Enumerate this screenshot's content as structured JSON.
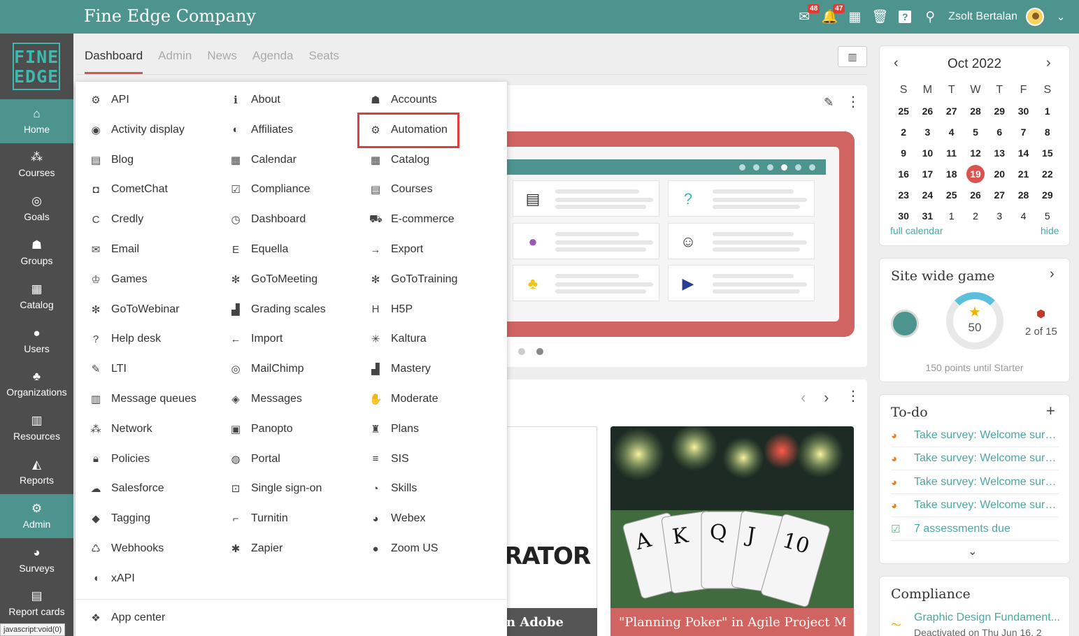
{
  "header": {
    "company": "Fine Edge Company",
    "mail_count": "48",
    "notif_count": "47",
    "user_name": "Zsolt Bertalan"
  },
  "logo": {
    "line1": "FINE",
    "line2": "EDGE"
  },
  "sidebar": {
    "items": [
      {
        "label": "Home",
        "icon": "home-icon"
      },
      {
        "label": "Courses",
        "icon": "courses-icon"
      },
      {
        "label": "Goals",
        "icon": "goals-icon"
      },
      {
        "label": "Groups",
        "icon": "groups-icon"
      },
      {
        "label": "Catalog",
        "icon": "catalog-icon"
      },
      {
        "label": "Users",
        "icon": "users-icon"
      },
      {
        "label": "Organizations",
        "icon": "organizations-icon"
      },
      {
        "label": "Resources",
        "icon": "resources-icon"
      },
      {
        "label": "Reports",
        "icon": "reports-icon"
      },
      {
        "label": "Admin",
        "icon": "admin-icon"
      },
      {
        "label": "Surveys",
        "icon": "surveys-icon"
      },
      {
        "label": "Report cards",
        "icon": "report-cards-icon"
      }
    ]
  },
  "status_bar": "javascript:void(0)",
  "tabs": [
    "Dashboard",
    "Admin",
    "News",
    "Agenda",
    "Seats"
  ],
  "admin_menu": {
    "col1": [
      "API",
      "Activity display",
      "Blog",
      "CometChat",
      "Credly",
      "Email",
      "Games",
      "GoToWebinar",
      "Help desk",
      "LTI",
      "Message queues",
      "Network",
      "Policies",
      "Salesforce",
      "Tagging",
      "Webhooks",
      "xAPI"
    ],
    "col2": [
      "About",
      "Affiliates",
      "Calendar",
      "Compliance",
      "Dashboard",
      "Equella",
      "GoToMeeting",
      "Grading scales",
      "Import",
      "MailChimp",
      "Messages",
      "Panopto",
      "Portal",
      "Single sign-on",
      "Turnitin",
      "Zapier"
    ],
    "col3": [
      "Accounts",
      "Automation",
      "Catalog",
      "Courses",
      "E-commerce",
      "Export",
      "GoToTraining",
      "H5P",
      "Kaltura",
      "Mastery",
      "Moderate",
      "Plans",
      "SIS",
      "Skills",
      "Webex",
      "Zoom US"
    ],
    "highlighted": "Automation",
    "app_center": "App center"
  },
  "featured": {
    "left_title": "n Adobe",
    "left_image_text": "RATOR",
    "right_title": "\"Planning Poker\" in Agile Project M"
  },
  "calendar": {
    "month": "Oct 2022",
    "weekdays": [
      "S",
      "M",
      "T",
      "W",
      "T",
      "F",
      "S"
    ],
    "weeks": [
      [
        "25",
        "26",
        "27",
        "28",
        "29",
        "30",
        "1"
      ],
      [
        "2",
        "3",
        "4",
        "5",
        "6",
        "7",
        "8"
      ],
      [
        "9",
        "10",
        "11",
        "12",
        "13",
        "14",
        "15"
      ],
      [
        "16",
        "17",
        "18",
        "19",
        "20",
        "21",
        "22"
      ],
      [
        "23",
        "24",
        "25",
        "26",
        "27",
        "28",
        "29"
      ],
      [
        "30",
        "31",
        "1",
        "2",
        "3",
        "4",
        "5"
      ]
    ],
    "today": "19",
    "full_calendar": "full calendar",
    "hide": "hide"
  },
  "game": {
    "title": "Site wide game",
    "points": "50",
    "rank": "2 of 15",
    "until": "150 points until Starter",
    "progress": 0.08
  },
  "todo": {
    "title": "To-do",
    "items": [
      "Take survey: Welcome surv...",
      "Take survey: Welcome surv...",
      "Take survey: Welcome surv...",
      "Take survey: Welcome surv...",
      "7 assessments due"
    ]
  },
  "compliance": {
    "title": "Compliance",
    "item": "Graphic Design Fundament...",
    "sub": "Deactivated on Thu Jun 16, 2"
  },
  "colors": {
    "accent": "#4e948e",
    "sidebar": "#4d4d4d",
    "highlight": "#e23b3b",
    "banner": "#d06460"
  }
}
